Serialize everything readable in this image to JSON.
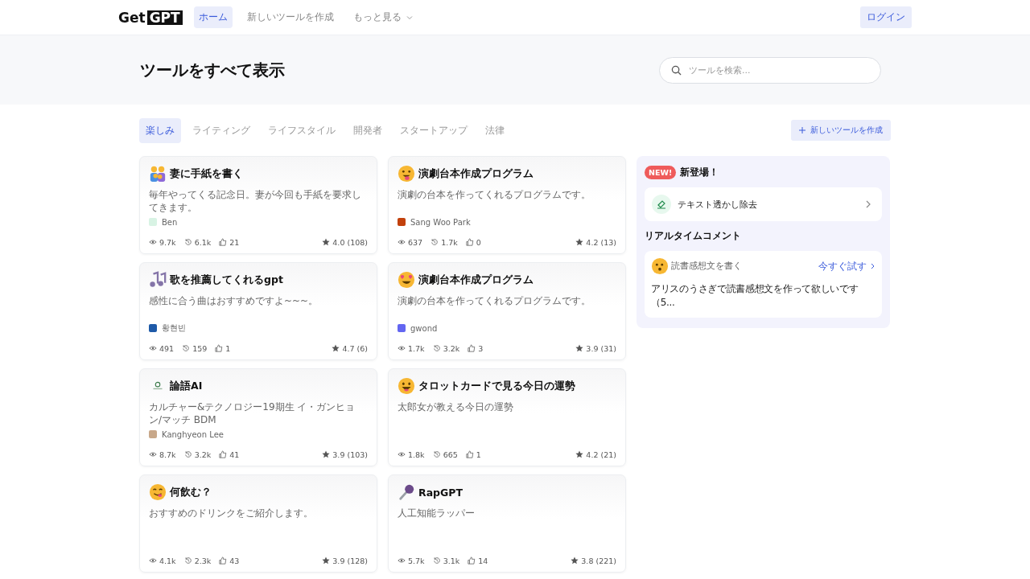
{
  "header": {
    "logo": {
      "left": "Get",
      "boxed": "GPT"
    },
    "nav": [
      {
        "label": "ホーム",
        "selected": true
      },
      {
        "label": "新しいツールを作成",
        "selected": false
      },
      {
        "label": "もっと見る",
        "selected": false,
        "dropdown": true
      }
    ],
    "login": "ログイン"
  },
  "hero": {
    "title": "ツールをすべて表示",
    "search": {
      "placeholder": "ツールを検索..."
    }
  },
  "categories": [
    {
      "label": "楽しみ",
      "selected": true
    },
    {
      "label": "ライティング",
      "selected": false
    },
    {
      "label": "ライフスタイル",
      "selected": false
    },
    {
      "label": "開発者",
      "selected": false
    },
    {
      "label": "スタートアップ",
      "selected": false
    },
    {
      "label": "法律",
      "selected": false
    }
  ],
  "create_button": "新しいツールを作成",
  "tools": [
    {
      "title": "妻に手紙を書く",
      "description": "毎年やってくる記念日。妻が今回も手紙を要求してきます。",
      "author": "Ben",
      "color": "#d8f3e4",
      "views": "9.7k",
      "uses": "6.1k",
      "likes": "21",
      "rating": "4.0 (108)"
    },
    {
      "title": "演劇台本作成プログラム",
      "description": "演劇の台本を作ってくれるプログラムです。",
      "author": "Sang Woo Park",
      "color": "#c2410c",
      "views": "637",
      "uses": "1.7k",
      "likes": "0",
      "rating": "4.2 (13)"
    },
    {
      "title": "歌を推薦してくれるgpt",
      "description": "感性に合う曲はおすすめですよ~~~。",
      "author": "황현빈",
      "color": "#1e5aa8",
      "views": "491",
      "uses": "159",
      "likes": "1",
      "rating": "4.7 (6)"
    },
    {
      "title": "演劇台本作成プログラム",
      "description": "演劇の台本を作ってくれるプログラムです。",
      "author": "gwond",
      "color": "#6366f1",
      "views": "1.7k",
      "uses": "3.2k",
      "likes": "3",
      "rating": "3.9 (31)"
    },
    {
      "title": "論語AI",
      "description": "カルチャー&テクノロジー19期生 イ・ガンヒョン/マッチ BDM",
      "author": "Kanghyeon Lee",
      "color": "#c8a88a",
      "views": "8.7k",
      "uses": "3.2k",
      "likes": "41",
      "rating": "3.9 (103)"
    },
    {
      "title": "タロットカードで見る今日の運勢",
      "description": "太郎女が教える今日の運勢",
      "views": "1.8k",
      "uses": "665",
      "likes": "1",
      "rating": "4.2 (21)"
    },
    {
      "title": "何飲む？",
      "description": "おすすめのドリンクをご紹介します。",
      "views": "4.1k",
      "uses": "2.3k",
      "likes": "43",
      "rating": "3.9 (128)"
    },
    {
      "title": "RapGPT",
      "description": "人工知能ラッパー",
      "views": "5.7k",
      "uses": "3.1k",
      "likes": "14",
      "rating": "3.8 (221)"
    }
  ],
  "sidebar": {
    "badge": "NEW!",
    "heading": "新登場！",
    "new_tool": "テキスト透かし除去",
    "comments_heading": "リアルタイムコメント",
    "comment": {
      "tool": "読書感想文を書く",
      "action": "今すぐ試す",
      "text": "アリスのうさぎで読書感想文を作って欲しいです（5..."
    }
  }
}
